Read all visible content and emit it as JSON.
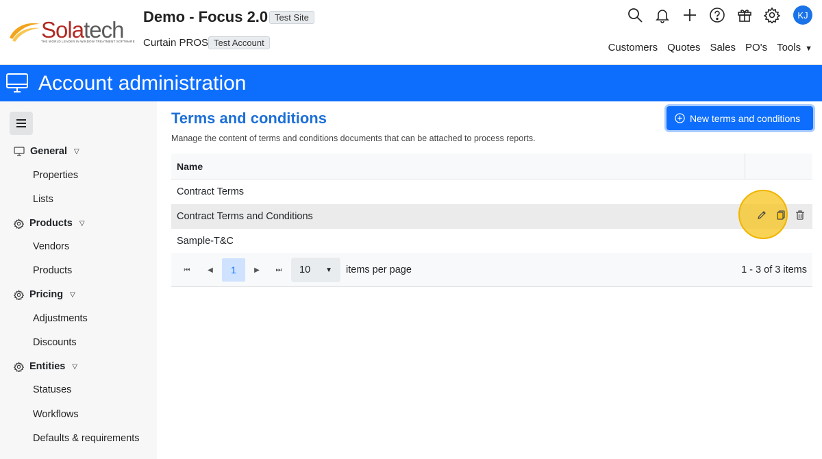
{
  "header": {
    "logo_text_a": "Sola",
    "logo_text_b": "tech",
    "logo_tagline": "THE WORLD LEADER IN WINDOW TREATMENT SOFTWARE",
    "site_title": "Demo - Focus 2.0",
    "site_badge": "Test Site",
    "account_name": "Curtain PROS",
    "account_badge": "Test Account",
    "avatar_initials": "KJ",
    "nav": [
      "Customers",
      "Quotes",
      "Sales",
      "PO's",
      "Tools"
    ]
  },
  "banner": {
    "title": "Account administration"
  },
  "sidebar": {
    "groups": [
      {
        "label": "General",
        "icon": "monitor-icon",
        "items": [
          "Properties",
          "Lists"
        ]
      },
      {
        "label": "Products",
        "icon": "gear-icon",
        "items": [
          "Vendors",
          "Products"
        ]
      },
      {
        "label": "Pricing",
        "icon": "gear-icon",
        "items": [
          "Adjustments",
          "Discounts"
        ]
      },
      {
        "label": "Entities",
        "icon": "gear-icon",
        "items": [
          "Statuses",
          "Workflows",
          "Defaults & requirements"
        ]
      }
    ]
  },
  "main": {
    "title": "Terms and conditions",
    "description": "Manage the content of terms and conditions documents that can be attached to process reports.",
    "new_button": "New terms and conditions",
    "table": {
      "column_name": "Name",
      "rows": [
        "Contract Terms",
        "Contract Terms and Conditions",
        "Sample-T&C"
      ]
    },
    "pager": {
      "current_page": "1",
      "page_size": "10",
      "items_per_page_label": "items per page",
      "info": "1 - 3 of 3 items"
    }
  },
  "colors": {
    "accent": "#0d6efd",
    "title": "#1d6fd6",
    "highlight": "#f7c41e"
  }
}
